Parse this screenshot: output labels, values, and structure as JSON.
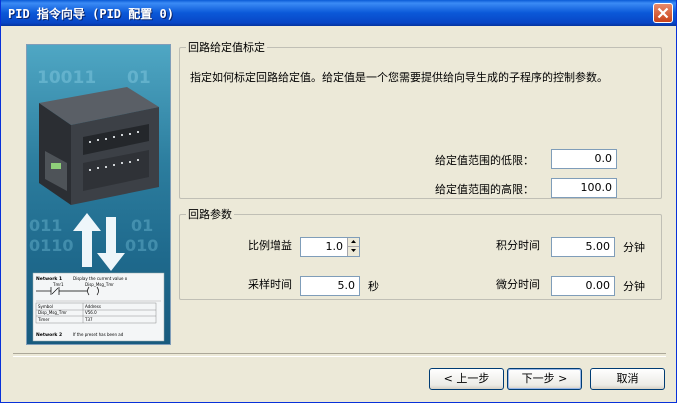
{
  "window": {
    "title": "PID 指令向导 (PID 配置 0)"
  },
  "setpoint_group": {
    "legend": "回路给定值标定",
    "description": "指定如何标定回路给定值。给定值是一个您需要提供给向导生成的子程序的控制参数。",
    "low_label": "给定值范围的低限：",
    "low_value": "0.0",
    "high_label": "给定值范围的高限：",
    "high_value": "100.0"
  },
  "params_group": {
    "legend": "回路参数",
    "gain_label": "比例增益",
    "gain_value": "1.0",
    "sample_label": "采样时间",
    "sample_value": "5.0",
    "sample_unit": "秒",
    "integral_label": "积分时间",
    "integral_value": "5.00",
    "integral_unit": "分钟",
    "derivative_label": "微分时间",
    "derivative_value": "0.00",
    "derivative_unit": "分钟"
  },
  "sidebar_image": {
    "network1_label": "Network 1",
    "network1_comment": "Display the current value o",
    "contact_label": "Tmr1",
    "coil_label": "Disp_Msg_Tmr",
    "symbol_header": "Symbol",
    "address_header": "Address",
    "row1_symbol": "Disp_Msg_Tmr",
    "row1_address": "V56.0",
    "row2_symbol": "Timer",
    "row2_address": "T37",
    "network2_label": "Network 2",
    "network2_comment": "If the preset has been ad"
  },
  "buttons": {
    "back": "< 上一步",
    "next": "下一步 >",
    "cancel": "取消"
  },
  "colors": {
    "titlebar": "#0a58d8",
    "window_bg": "#ece9d8",
    "sidebar_bg": "#2c7d9e"
  }
}
